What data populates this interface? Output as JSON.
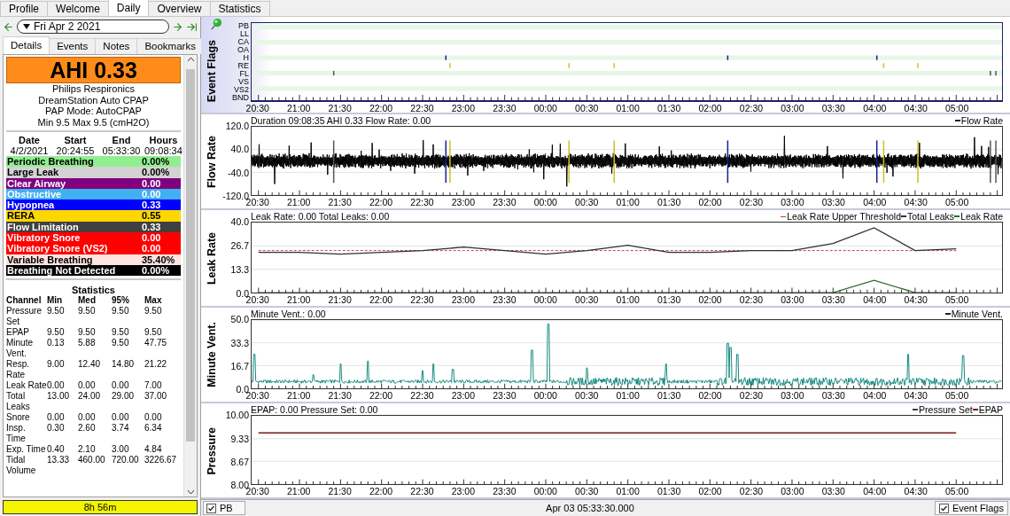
{
  "main_tabs": [
    {
      "label": "Profile",
      "selected": false
    },
    {
      "label": "Welcome",
      "selected": false
    },
    {
      "label": "Daily",
      "selected": true
    },
    {
      "label": "Overview",
      "selected": false
    },
    {
      "label": "Statistics",
      "selected": false
    }
  ],
  "date_nav": {
    "date": "Fri Apr 2 2021"
  },
  "detail_tabs": [
    {
      "label": "Details",
      "selected": true
    },
    {
      "label": "Events",
      "selected": false
    },
    {
      "label": "Notes",
      "selected": false
    },
    {
      "label": "Bookmarks",
      "selected": false
    }
  ],
  "summary": {
    "ahi": "AHI 0.33",
    "device_lines": [
      "Philips Respironics",
      "DreamStation Auto CPAP",
      "PAP Mode: AutoCPAP",
      "Min 9.5 Max 9.5 (cmH2O)"
    ]
  },
  "session": {
    "columns": [
      "Date",
      "Start",
      "End",
      "Hours"
    ],
    "values": [
      "4/2/2021",
      "20:24:55",
      "05:33:30",
      "09:08:34"
    ]
  },
  "event_indices": [
    {
      "name": "Periodic Breathing",
      "value": "0.00%",
      "color": "#90ee90"
    },
    {
      "name": "Large Leak",
      "value": "0.00%",
      "color": "#d3d3d3"
    },
    {
      "name": "Clear Airway",
      "value": "0.00",
      "color": "#800080"
    },
    {
      "name": "Obstructive",
      "value": "0.00",
      "color": "#40b0f0"
    },
    {
      "name": "Hypopnea",
      "value": "0.33",
      "color": "#0000ff"
    },
    {
      "name": "RERA",
      "value": "0.55",
      "color": "#ffd700"
    },
    {
      "name": "Flow Limitation",
      "value": "0.33",
      "color": "#404040"
    },
    {
      "name": "Vibratory Snore",
      "value": "0.00",
      "color": "#ff0000"
    },
    {
      "name": "Vibratory Snore (VS2)",
      "value": "0.00",
      "color": "#ff0000"
    },
    {
      "name": "Variable Breathing",
      "value": "35.40%",
      "color": "#ffe4e1"
    },
    {
      "name": "Breathing Not Detected",
      "value": "0.00%",
      "color": "#000000"
    }
  ],
  "statistics": {
    "title": "Statistics",
    "columns": [
      "Channel",
      "Min",
      "Med",
      "95%",
      "Max"
    ],
    "rows": [
      [
        "Pressure Set",
        "9.50",
        "9.50",
        "9.50",
        "9.50"
      ],
      [
        "EPAP",
        "9.50",
        "9.50",
        "9.50",
        "9.50"
      ],
      [
        "Minute Vent.",
        "0.13",
        "5.88",
        "9.50",
        "47.75"
      ],
      [
        "Resp. Rate",
        "9.00",
        "12.40",
        "14.80",
        "21.22"
      ],
      [
        "Leak Rate",
        "0.00",
        "0.00",
        "0.00",
        "7.00"
      ],
      [
        "Total Leaks",
        "13.00",
        "24.00",
        "29.00",
        "37.00"
      ],
      [
        "Snore",
        "0.00",
        "0.00",
        "0.00",
        "0.00"
      ],
      [
        "Insp. Time",
        "0.30",
        "2.60",
        "3.74",
        "6.34"
      ],
      [
        "Exp. Time",
        "0.40",
        "2.10",
        "3.00",
        "4.84"
      ],
      [
        "Tidal Volume",
        "13.33",
        "460.00",
        "720.00",
        "3226.67"
      ]
    ]
  },
  "usage_bar": {
    "label": "8h 56m"
  },
  "graphs": [
    {
      "kind": "flags",
      "title": "Event Flags",
      "rows": [
        "PB",
        "LL",
        "CA",
        "OA",
        "H",
        "RE",
        "FL",
        "VS",
        "VS2",
        "BND"
      ],
      "xticks": [
        "20:30",
        "21:00",
        "21:30",
        "22:00",
        "22:30",
        "23:00",
        "23:30",
        "00:00",
        "00:30",
        "01:00",
        "01:30",
        "02:00",
        "02:30",
        "03:00",
        "03:30",
        "04:00",
        "04:30",
        "05:00"
      ]
    },
    {
      "kind": "flow",
      "title": "Flow Rate",
      "info": "Duration 09:08:35 AHI 0.33 Flow Rate: 0.00",
      "legend": [
        "Flow Rate"
      ],
      "yticks": [
        "120.0",
        "40.0",
        "-40.0",
        "-120.0"
      ],
      "xticks": [
        "20:30",
        "21:00",
        "21:30",
        "22:00",
        "22:30",
        "23:00",
        "23:30",
        "00:00",
        "00:30",
        "01:00",
        "01:30",
        "02:00",
        "02:30",
        "03:00",
        "03:30",
        "04:00",
        "04:30",
        "05:00"
      ]
    },
    {
      "kind": "chart",
      "info": "Leak Rate: 0.00 Total Leaks: 0.00",
      "chart_data": {
        "type": "line",
        "ylabel": "Leak Rate",
        "ylim": [
          0,
          40
        ],
        "legend": "upper right",
        "categories": [
          "20:30",
          "21:00",
          "21:30",
          "22:00",
          "22:30",
          "23:00",
          "23:30",
          "00:00",
          "00:30",
          "01:00",
          "01:30",
          "02:00",
          "02:30",
          "03:00",
          "03:30",
          "04:00",
          "04:30",
          "05:00"
        ],
        "yticks": [
          {
            "value": 40,
            "label": "40.0"
          },
          {
            "value": 26.7,
            "label": "26.7"
          },
          {
            "value": 13.3,
            "label": "13.3"
          },
          {
            "value": 0,
            "label": "0.0"
          }
        ],
        "series": [
          {
            "name": "Leak Rate Upper Threshold",
            "color": "#c04040",
            "line_style": "dashed",
            "values": [
              24,
              24,
              24,
              24,
              24,
              24,
              24,
              24,
              24,
              24,
              24,
              24,
              24,
              24,
              24,
              24,
              24,
              24
            ]
          },
          {
            "name": "Total Leaks",
            "color": "#303030",
            "values": [
              23,
              23,
              22,
              23,
              24,
              26,
              24,
              22,
              24,
              27,
              23,
              23,
              24,
              24,
              28,
              37,
              24,
              25
            ]
          },
          {
            "name": "Leak Rate",
            "color": "#2e6b2e",
            "values": [
              0,
              0,
              0,
              0,
              0,
              0,
              0,
              0,
              0,
              0,
              0,
              0,
              0,
              0,
              0,
              7,
              0,
              0
            ]
          }
        ]
      }
    },
    {
      "kind": "spikes",
      "title": "Minute Vent.",
      "info": "Minute Vent.: 0.00",
      "legend": [
        "Minute Vent."
      ],
      "yticks": [
        "50.0",
        "33.3",
        "16.7",
        "0.0"
      ],
      "xticks": [
        "20:30",
        "21:00",
        "21:30",
        "22:00",
        "22:30",
        "23:00",
        "23:30",
        "00:00",
        "00:30",
        "01:00",
        "01:30",
        "02:00",
        "02:30",
        "03:00",
        "03:30",
        "04:00",
        "04:30",
        "05:00"
      ]
    },
    {
      "kind": "chart",
      "info": "EPAP: 0.00 Pressure Set: 0.00",
      "chart_data": {
        "type": "line",
        "ylabel": "Pressure",
        "ylim": [
          8,
          10
        ],
        "legend": "upper right",
        "categories": [
          "20:30",
          "21:00",
          "21:30",
          "22:00",
          "22:30",
          "23:00",
          "23:30",
          "00:00",
          "00:30",
          "01:00",
          "01:30",
          "02:00",
          "02:30",
          "03:00",
          "03:30",
          "04:00",
          "04:30",
          "05:00"
        ],
        "yticks": [
          {
            "value": 10,
            "label": "10.00"
          },
          {
            "value": 9.33,
            "label": "9.33"
          },
          {
            "value": 8.67,
            "label": "8.67"
          },
          {
            "value": 8,
            "label": "8.00"
          }
        ],
        "series": [
          {
            "name": "Pressure Set",
            "color": "#404040",
            "values": [
              null,
              null,
              null,
              null,
              null,
              null,
              null,
              null,
              null,
              null,
              null,
              null,
              null,
              null,
              null,
              null,
              null,
              null
            ]
          },
          {
            "name": "EPAP",
            "color": "#7a1a1a",
            "values": [
              9.5,
              9.5,
              9.5,
              9.5,
              9.5,
              9.5,
              9.5,
              9.5,
              9.5,
              9.5,
              9.5,
              9.5,
              9.5,
              9.5,
              9.5,
              9.5,
              9.5,
              9.5
            ]
          }
        ]
      }
    }
  ],
  "status_bar": {
    "channel": {
      "label": "PB",
      "checked": true
    },
    "time": "Apr 03 05:33:30.000",
    "event_flags": {
      "label": "Event Flags",
      "checked": true
    }
  }
}
